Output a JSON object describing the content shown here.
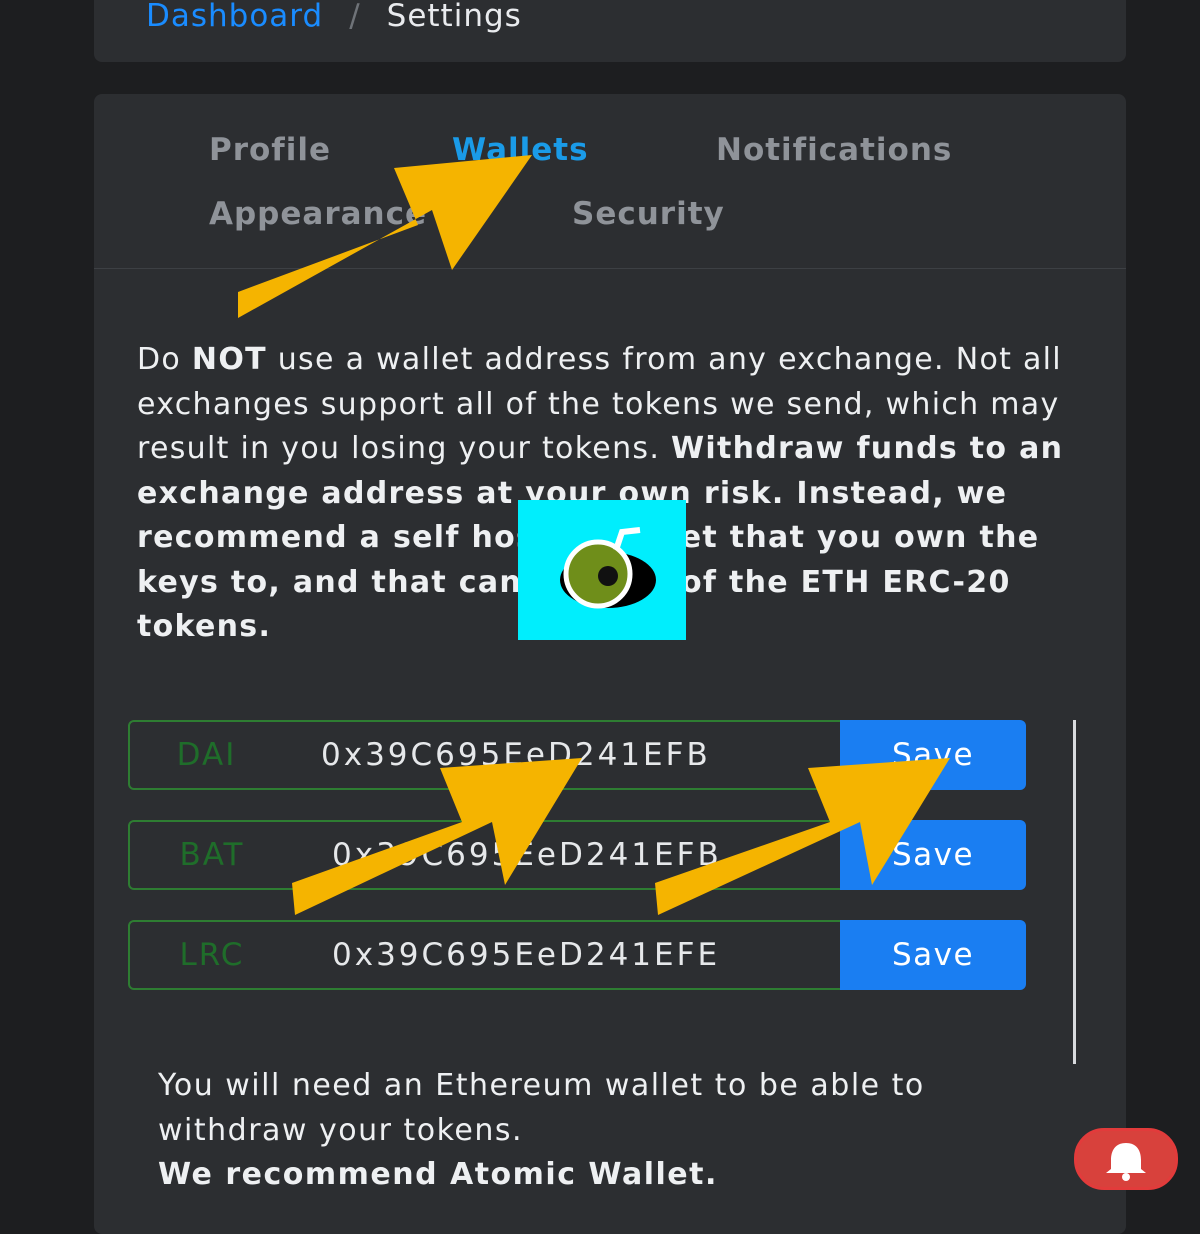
{
  "breadcrumb": {
    "link": "Dashboard",
    "separator": "/",
    "current": "Settings"
  },
  "tabs": [
    {
      "label": "Profile",
      "active": false
    },
    {
      "label": "Wallets",
      "active": true
    },
    {
      "label": "Notifications",
      "active": false
    },
    {
      "label": "Appearance",
      "active": false
    },
    {
      "label": "Security",
      "active": false
    }
  ],
  "warning": {
    "p1": "Do ",
    "p2": "NOT",
    "p3": " use a wallet address from any exchange. Not all exchanges support all of the tokens we send, which may result in you losing your tokens. ",
    "p4": "Withdraw funds to an exchange address at your own risk. Instead, we recommend a self hosted wallet that you own the keys to, and that can hold all of the ETH ERC-20 tokens."
  },
  "wallets": [
    {
      "token": "DAI",
      "address": "0x39C695EeD241EFB",
      "save_label": "Save"
    },
    {
      "token": "BAT",
      "address": "0x39C695EeD241EFB",
      "save_label": "Save"
    },
    {
      "token": "LRC",
      "address": "0x39C695EeD241EFE",
      "save_label": "Save"
    }
  ],
  "info": {
    "line1": "You will need an Ethereum wallet to be able to withdraw your tokens.",
    "line2": "We recommend Atomic Wallet."
  },
  "colors": {
    "accent": "#1a7ef2",
    "tab_active": "#1a9be8",
    "token_border": "#2e7d32",
    "arrow": "#f5b400"
  },
  "icons": {
    "notification": "bell-icon",
    "watermark": "logo-icon",
    "annotation": "arrow-icon"
  }
}
